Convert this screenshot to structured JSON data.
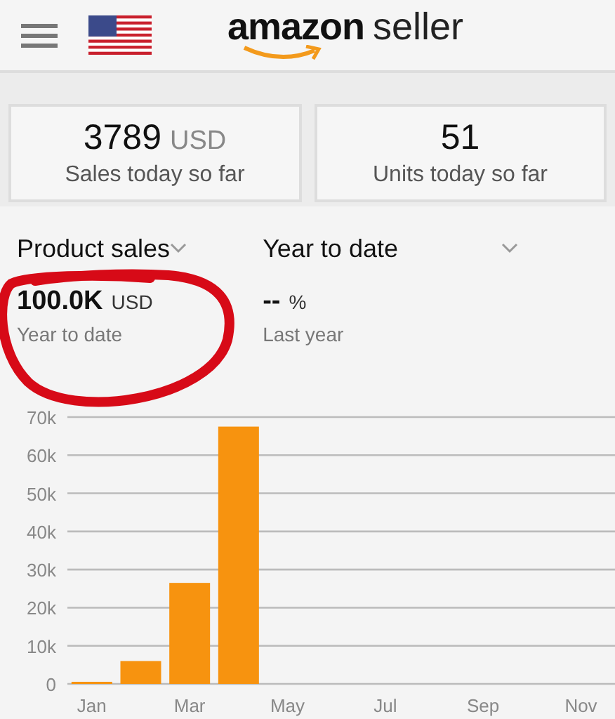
{
  "header": {
    "logo_brand": "amazon",
    "logo_suffix": "seller"
  },
  "summary_cards": [
    {
      "value": "3789",
      "unit": "USD",
      "label": "Sales today so far"
    },
    {
      "value": "51",
      "label": "Units today so far"
    }
  ],
  "selectors": [
    {
      "label": "Product sales"
    },
    {
      "label": "Year to date"
    }
  ],
  "metrics": [
    {
      "value": "100.0K",
      "unit": "USD",
      "label": "Year to date"
    },
    {
      "value": "--",
      "unit": "%",
      "label": "Last year"
    }
  ],
  "chart": {
    "chart_data": {
      "type": "bar",
      "categories": [
        "Jan",
        null,
        "Mar",
        null,
        "May",
        null,
        "Jul",
        null,
        "Sep",
        null,
        "Nov",
        null
      ],
      "values": [
        0,
        6000,
        26500,
        67500,
        null,
        null,
        null,
        null,
        null,
        null,
        null,
        null
      ],
      "ylim": [
        0,
        70000
      ],
      "grid": true,
      "yticks": [
        {
          "value": 0,
          "label": "0"
        },
        {
          "value": 10000,
          "label": "10k"
        },
        {
          "value": 20000,
          "label": "20k"
        },
        {
          "value": 30000,
          "label": "30k"
        },
        {
          "value": 40000,
          "label": "40k"
        },
        {
          "value": 50000,
          "label": "50k"
        },
        {
          "value": 60000,
          "label": "60k"
        },
        {
          "value": 70000,
          "label": "70k"
        }
      ]
    }
  }
}
